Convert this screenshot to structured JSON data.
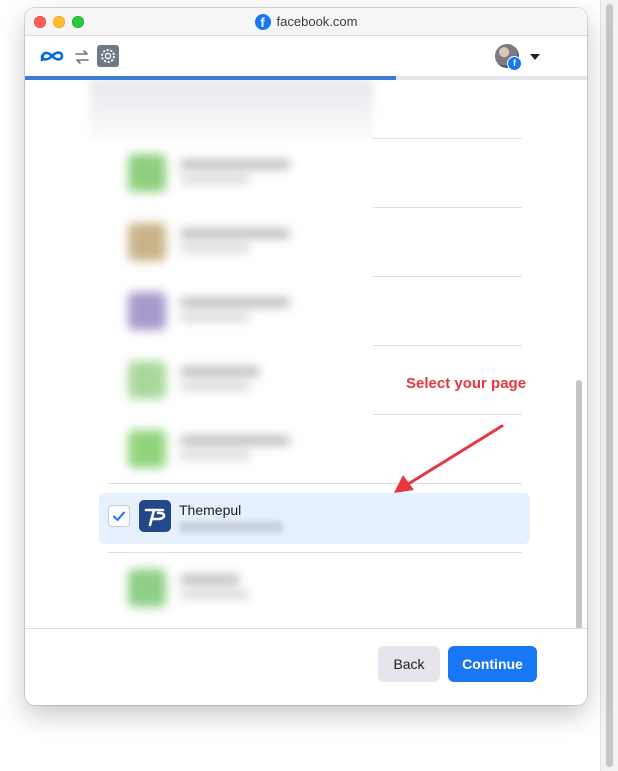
{
  "browser": {
    "url_title": "facebook.com",
    "favicon_letter": "f"
  },
  "toolbar": {
    "progress": 0.66,
    "avatar_badge_letter": "f"
  },
  "list": {
    "selected_item": {
      "name": "Themepul",
      "checked": true
    }
  },
  "annotation": {
    "text": "Select your page",
    "color": "#e8363f"
  },
  "footer": {
    "back_label": "Back",
    "continue_label": "Continue"
  },
  "colors": {
    "brand_blue": "#1877f2",
    "selected_row_bg": "#e7f1fd",
    "progress_blue": "#3a7bd5"
  },
  "icons": [
    "meta-logo-icon",
    "swap-icon",
    "settings-icon",
    "chevron-down-icon",
    "checkmark-icon",
    "arrow-icon"
  ]
}
